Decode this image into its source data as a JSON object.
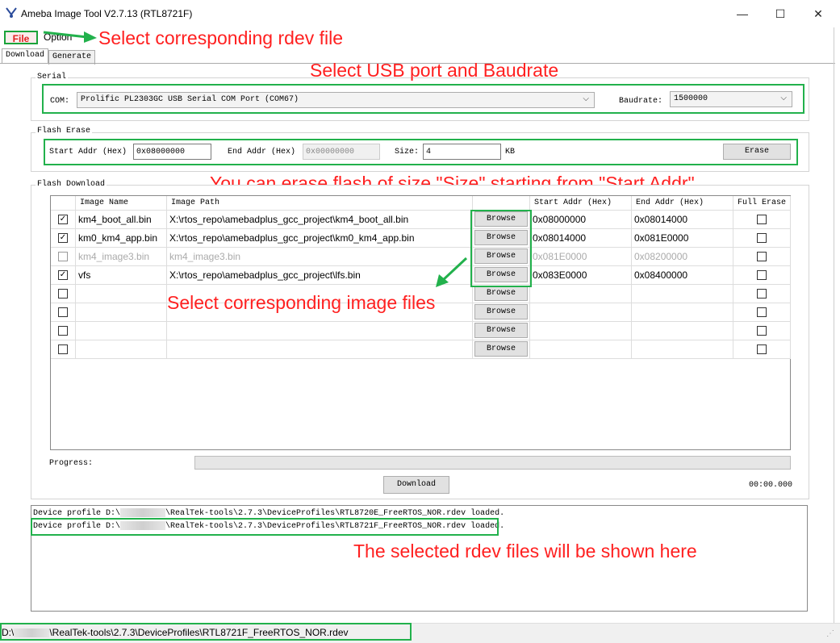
{
  "window": {
    "title": "Ameba Image Tool V2.7.13 (RTL8721F)",
    "minimize": "—",
    "maximize": "☐",
    "close": "✕"
  },
  "menu": {
    "file": "File",
    "option": "Option"
  },
  "tabs": [
    {
      "label": "Download"
    },
    {
      "label": "Generate"
    }
  ],
  "serial": {
    "group_label": "Serial",
    "com_label": "COM:",
    "com_value": "Prolific PL2303GC USB Serial COM Port (COM67)",
    "baud_label": "Baudrate:",
    "baud_value": "1500000"
  },
  "flash_erase": {
    "group_label": "Flash Erase",
    "start_label": "Start Addr (Hex)",
    "start_value": "0x08000000",
    "end_label": "End Addr (Hex)",
    "end_value": "0x00000000",
    "size_label": "Size:",
    "size_value": "4",
    "size_unit": "KB",
    "erase_button": "Erase"
  },
  "flash_download": {
    "group_label": "Flash Download",
    "headers": [
      "Image Name",
      "Image Path",
      "Start Addr (Hex)",
      "End Addr (Hex)",
      "Full Erase"
    ],
    "browse_label": "Browse",
    "rows": [
      {
        "checked": true,
        "enabled": true,
        "name": "km4_boot_all.bin",
        "path": "X:\\rtos_repo\\amebadplus_gcc_project\\km4_boot_all.bin",
        "start": "0x08000000",
        "end": "0x08014000"
      },
      {
        "checked": true,
        "enabled": true,
        "name": "km0_km4_app.bin",
        "path": "X:\\rtos_repo\\amebadplus_gcc_project\\km0_km4_app.bin",
        "start": "0x08014000",
        "end": "0x081E0000"
      },
      {
        "checked": false,
        "enabled": false,
        "name": "km4_image3.bin",
        "path": "km4_image3.bin",
        "start": "0x081E0000",
        "end": "0x08200000"
      },
      {
        "checked": true,
        "enabled": true,
        "name": "vfs",
        "path": "X:\\rtos_repo\\amebadplus_gcc_project\\lfs.bin",
        "start": "0x083E0000",
        "end": "0x08400000"
      },
      {
        "checked": false,
        "enabled": true,
        "name": "",
        "path": "",
        "start": "",
        "end": ""
      },
      {
        "checked": false,
        "enabled": true,
        "name": "",
        "path": "",
        "start": "",
        "end": ""
      },
      {
        "checked": false,
        "enabled": true,
        "name": "",
        "path": "",
        "start": "",
        "end": ""
      },
      {
        "checked": false,
        "enabled": true,
        "name": "",
        "path": "",
        "start": "",
        "end": ""
      }
    ],
    "progress_label": "Progress:",
    "progress_value": 0,
    "download_button": "Download",
    "elapsed": "00:00.000"
  },
  "log": {
    "lines": [
      {
        "prefix": "Device profile D:\\",
        "suffix": "\\RealTek-tools\\2.7.3\\DeviceProfiles\\RTL8720E_FreeRTOS_NOR.rdev loaded."
      },
      {
        "prefix": "Device profile D:\\",
        "suffix": "\\RealTek-tools\\2.7.3\\DeviceProfiles\\RTL8721F_FreeRTOS_NOR.rdev loaded."
      }
    ]
  },
  "statusbar": {
    "prefix": "D:\\",
    "suffix": "\\RealTek-tools\\2.7.3\\DeviceProfiles\\RTL8721F_FreeRTOS_NOR.rdev"
  },
  "annotations": {
    "file": "Select corresponding rdev file",
    "serial": "Select USB port and Baudrate",
    "erase": "You can erase flash of size \"Size\" starting from \"Start Addr\"",
    "images": "Select corresponding image files",
    "log": "The selected rdev files will be shown here"
  },
  "colors": {
    "annotation_red": "#ff2020",
    "highlight_green": "#22b14c"
  }
}
